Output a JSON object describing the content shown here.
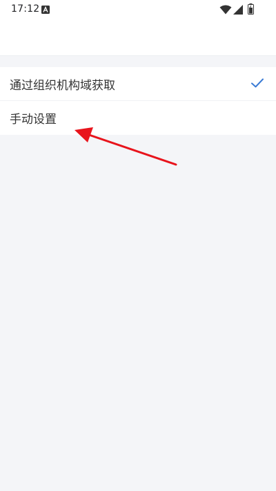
{
  "status_bar": {
    "time": "17:12",
    "icons": [
      "notification-a-icon",
      "wifi-icon",
      "signal-icon",
      "battery-icon"
    ]
  },
  "options": [
    {
      "label": "通过组织机构域获取",
      "selected": true
    },
    {
      "label": "手动设置",
      "selected": false
    }
  ],
  "colors": {
    "background": "#f4f5f8",
    "check": "#3a7bd5",
    "annotation_arrow": "#e8141c"
  }
}
